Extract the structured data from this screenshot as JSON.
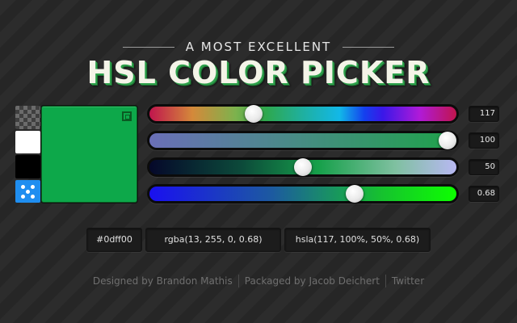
{
  "header": {
    "subtitle": "A MOST EXCELLENT",
    "title": "HSL COLOR PICKER"
  },
  "swatches": [
    {
      "name": "transparent-checker"
    },
    {
      "name": "white",
      "color": "#ffffff"
    },
    {
      "name": "black",
      "color": "#000000"
    },
    {
      "name": "random",
      "color": "#1f8ef0"
    }
  ],
  "preview": {
    "color": "#0da84a"
  },
  "sliders": [
    {
      "name": "hue",
      "value": "117",
      "fraction": 0.33
    },
    {
      "name": "saturation",
      "value": "100",
      "fraction": 1.0
    },
    {
      "name": "lightness",
      "value": "50",
      "fraction": 0.5
    },
    {
      "name": "alpha",
      "value": "0.68",
      "fraction": 0.68
    }
  ],
  "outputs": {
    "hex": "#0dff00",
    "rgba": "rgba(13, 255, 0, 0.68)",
    "hsla": "hsla(117, 100%, 50%, 0.68)"
  },
  "footer": {
    "designed": "Designed by Brandon Mathis",
    "packaged": "Packaged by Jacob Deichert",
    "twitter": "Twitter"
  },
  "colors": {
    "accent": "#0dff00",
    "title_shadow": "#2ea14b"
  }
}
